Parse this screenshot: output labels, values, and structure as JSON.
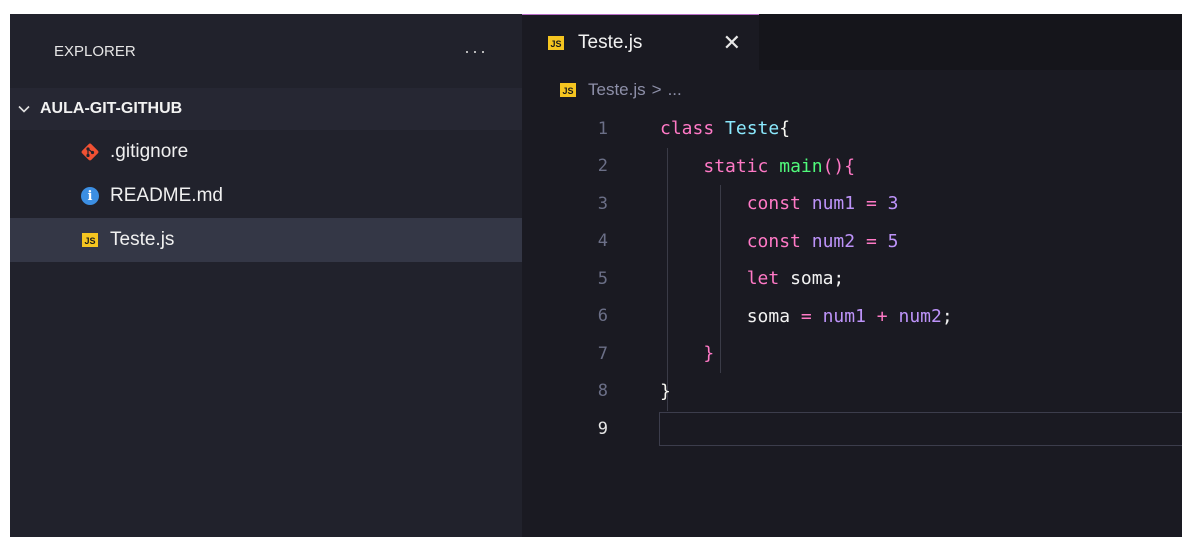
{
  "sidebar": {
    "title": "EXPLORER",
    "more": "···",
    "section": "AULA-GIT-GITHUB",
    "files": [
      {
        "name": ".gitignore",
        "icon": "git-icon"
      },
      {
        "name": "README.md",
        "icon": "info-icon"
      },
      {
        "name": "Teste.js",
        "icon": "js-file-icon",
        "active": true
      }
    ]
  },
  "editor": {
    "tab": {
      "label": "Teste.js",
      "close": "✕"
    },
    "breadcrumb": {
      "file": "Teste.js",
      "sep": ">",
      "rest": "..."
    },
    "js_badge": "JS",
    "line_numbers": [
      "1",
      "2",
      "3",
      "4",
      "5",
      "6",
      "7",
      "8",
      "9"
    ],
    "code": {
      "l1_kw": "class",
      "l1_name": "Teste",
      "l1_brace": "{",
      "l2_kw": "static",
      "l2_fn": "main",
      "l2_paren": "()",
      "l2_brace": "{",
      "l3_kw": "const",
      "l3_var": "num1",
      "l3_op": "=",
      "l3_num": "3",
      "l4_kw": "const",
      "l4_var": "num2",
      "l4_op": "=",
      "l4_num": "5",
      "l5_kw": "let",
      "l5_var": "soma",
      "l5_semi": ";",
      "l6_var": "soma",
      "l6_op": "=",
      "l6_a": "num1",
      "l6_plus": "+",
      "l6_b": "num2",
      "l6_semi": ";",
      "l7_brace": "}",
      "l8_brace": "}"
    }
  },
  "colors": {
    "keyword": "#ff79c6",
    "class_name": "#8be9fd",
    "function": "#50fa7b",
    "number": "#bd93f9",
    "js_badge": "#f5c520"
  }
}
